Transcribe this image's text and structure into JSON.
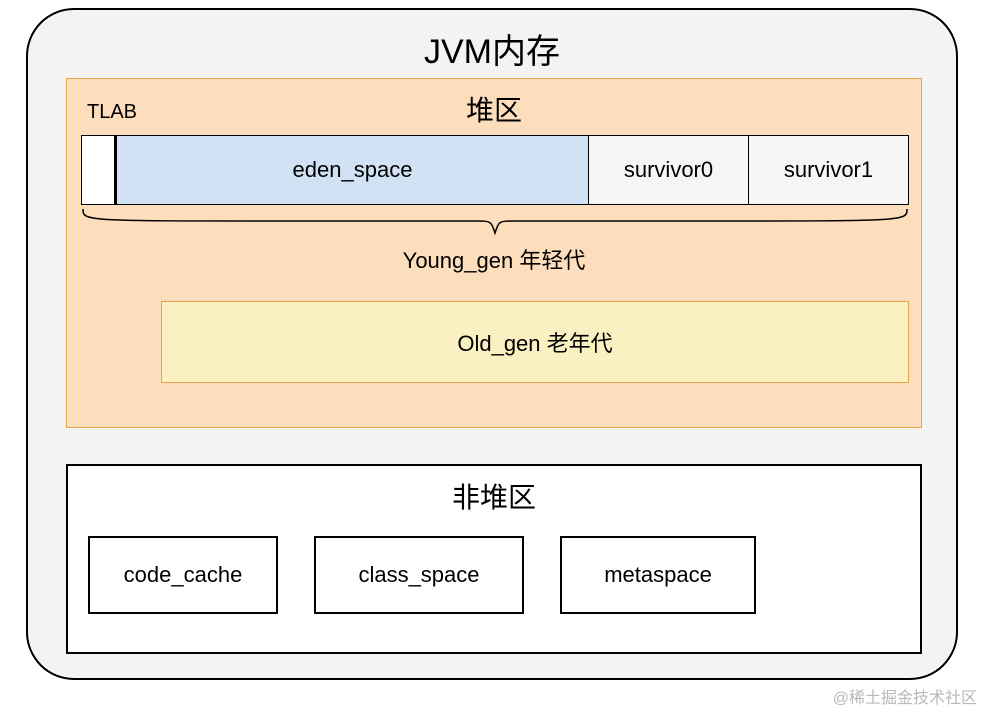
{
  "title": "JVM内存",
  "heap": {
    "title": "堆区",
    "tlab_label": "TLAB",
    "eden": "eden_space",
    "survivor0": "survivor0",
    "survivor1": "survivor1",
    "young_label": "Young_gen 年轻代",
    "old_label": "Old_gen 老年代"
  },
  "nonheap": {
    "title": "非堆区",
    "code_cache": "code_cache",
    "class_space": "class_space",
    "metaspace": "metaspace"
  },
  "watermark": "@稀土掘金技术社区"
}
